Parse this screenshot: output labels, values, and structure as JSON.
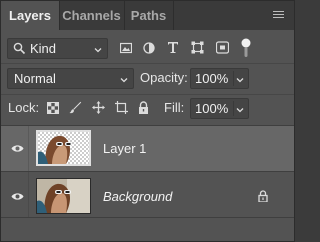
{
  "tabs": [
    {
      "label": "Layers",
      "active": true
    },
    {
      "label": "Channels",
      "active": false
    },
    {
      "label": "Paths",
      "active": false
    }
  ],
  "filter": {
    "value": "Kind",
    "icons": [
      "image-filter-icon",
      "adjustment-filter-icon",
      "type-filter-icon",
      "shape-filter-icon",
      "smart-object-filter-icon",
      "filter-toggle-icon"
    ]
  },
  "blend": {
    "value": "Normal"
  },
  "opacity": {
    "label": "Opacity:",
    "value": "100%"
  },
  "lock": {
    "label": "Lock:",
    "icons": [
      "lock-transparent-pixels-icon",
      "lock-image-pixels-icon",
      "lock-position-icon",
      "lock-artboard-icon",
      "lock-all-icon"
    ]
  },
  "fill": {
    "label": "Fill:",
    "value": "100%"
  },
  "layers": [
    {
      "name": "Layer 1",
      "selected": true,
      "visible": true,
      "locked": false
    },
    {
      "name": "Background",
      "selected": false,
      "visible": true,
      "locked": true
    }
  ],
  "colors": {
    "panel": "#535353",
    "tabbar": "#3a3a3a",
    "selected_row": "#676767"
  }
}
